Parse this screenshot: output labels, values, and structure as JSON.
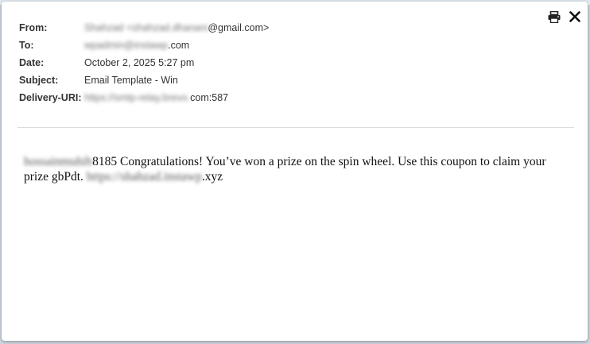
{
  "headers": {
    "from": {
      "label": "From:",
      "hidden": "Shahzad <shahzad.dhanani",
      "visible": "@gmail.com>"
    },
    "to": {
      "label": "To:",
      "hidden": "wpadmin@instawp",
      "visible": ".com"
    },
    "date": {
      "label": "Date:",
      "value": "October 2, 2025 5:27 pm"
    },
    "subject": {
      "label": "Subject:",
      "value": "Email Template - Win"
    },
    "delivery": {
      "label": "Delivery-URI:",
      "hidden": "https://smtp-relay.brevo.",
      "visible": "com:587"
    }
  },
  "message": {
    "name_hidden": "hossainmuhib",
    "part1": "8185 Congratulations!  You’ve won a prize on the spin wheel. Use this coupon to claim your prize gbPdt. ",
    "url_hidden": "https://shahzad.instawp",
    "part2": ".xyz"
  },
  "icons": {
    "print": "print-icon",
    "close": "close-icon"
  },
  "colors": {
    "text": "#333333",
    "divider": "#dcdcdc"
  }
}
